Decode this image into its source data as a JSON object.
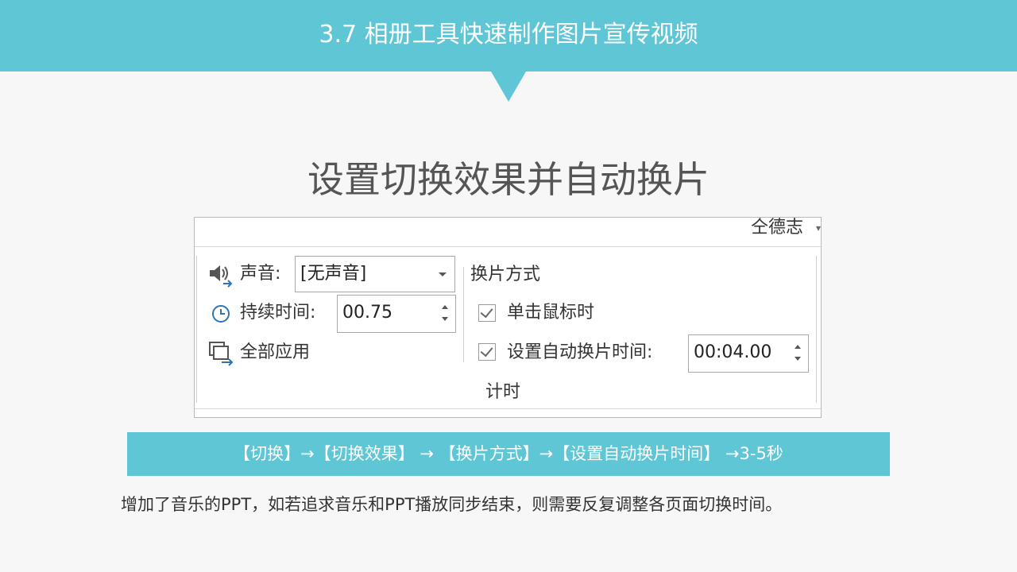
{
  "header": {
    "title": "3.7 相册工具快速制作图片宣传视频"
  },
  "slide": {
    "title": "设置切换效果并自动换片"
  },
  "ribbon": {
    "author": "仝德志",
    "sound": {
      "label": "声音:",
      "value": "[无声音]"
    },
    "duration": {
      "label": "持续时间:",
      "value": "00.75"
    },
    "apply_all": {
      "label": "全部应用"
    },
    "advance": {
      "heading": "换片方式",
      "on_click": {
        "label": "单击鼠标时",
        "checked": true
      },
      "after": {
        "label": "设置自动换片时间:",
        "checked": true,
        "value": "00:04.00"
      }
    },
    "group_label": "计时"
  },
  "banner": {
    "text": "【切换】→【切换效果】 → 【换片方式】→【设置自动换片时间】 →3-5秒"
  },
  "note": {
    "text": "增加了音乐的PPT，如若追求音乐和PPT播放同步结束，则需要反复调整各页面切换时间。"
  },
  "icons": [
    "speaker-icon",
    "clock-icon",
    "apply-all-icon",
    "chevron-down-icon"
  ],
  "colors": {
    "accent": "#5ec6d4",
    "background": "#f7f7f7",
    "text": "#333333"
  }
}
